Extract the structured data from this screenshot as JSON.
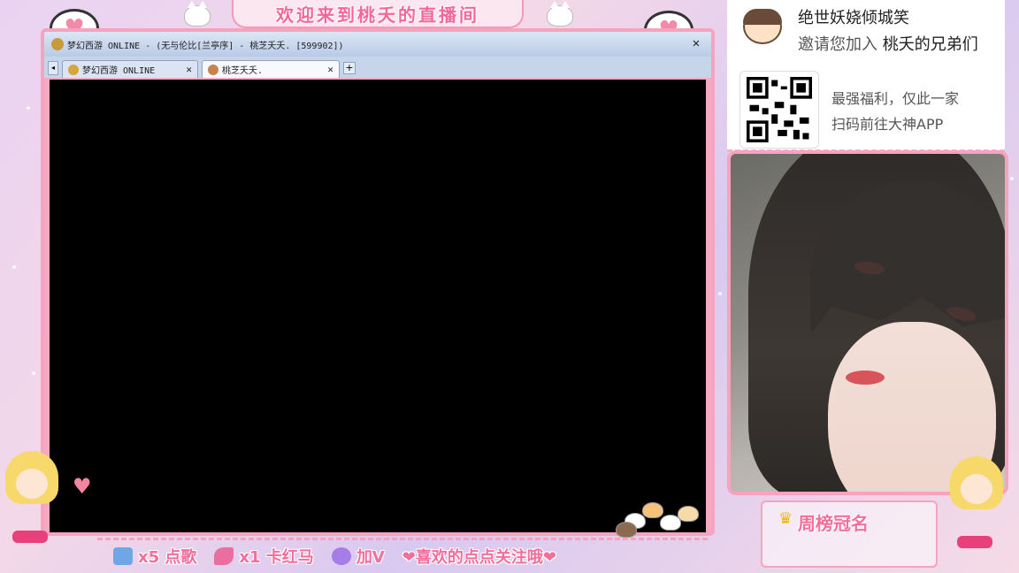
{
  "banner": {
    "welcome_text": "欢迎来到桃夭的直播间"
  },
  "game_window": {
    "title": "梦幻西游 ONLINE - (无与伦比[兰亭序] - 桃芝夭夭. [599902])",
    "close_glyph": "✕",
    "tabs": [
      {
        "label": "梦幻西游 ONLINE",
        "close": "✕",
        "active": false
      },
      {
        "label": "桃芝夭夭.",
        "close": "✕",
        "active": true
      }
    ],
    "add_tab_glyph": "+",
    "scroll_glyph": "◂"
  },
  "promo": {
    "line1": "绝世妖娆倾城笑",
    "line2_prefix": "邀请您加入",
    "line2_highlight": "桃夭的兄弟们",
    "side_line1": "最强福利，仅此一家",
    "side_line2": "扫码前往大神APP"
  },
  "bottom_bar": {
    "items": [
      {
        "text": "x5 点歌",
        "icon": "ticket-icon"
      },
      {
        "text": "x1 卡红马",
        "icon": "rocket-icon"
      },
      {
        "text": "加V",
        "icon": "wing-icon"
      },
      {
        "text": "❤喜欢的点点关注哦❤",
        "icon": ""
      }
    ]
  },
  "rank": {
    "label": "周榜冠名",
    "icon": "crown-icon"
  },
  "colors": {
    "accent": "#f26f9c",
    "frame": "#f5a3bf",
    "canvas": "#000000"
  }
}
